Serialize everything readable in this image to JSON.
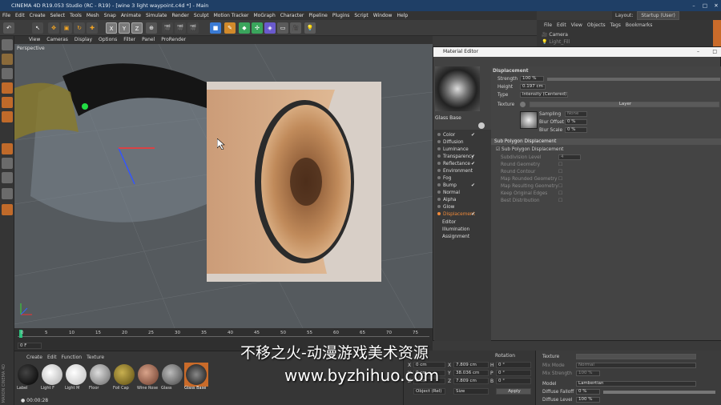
{
  "window": {
    "title": "CINEMA 4D R19.053 Studio (RC - R19) - [wine 3 light waypoint.c4d *] - Main"
  },
  "menu": [
    "File",
    "Edit",
    "Create",
    "Select",
    "Tools",
    "Mesh",
    "Snap",
    "Animate",
    "Simulate",
    "Render",
    "Sculpt",
    "Motion Tracker",
    "MoGraph",
    "Character",
    "Pipeline",
    "Plugins",
    "Script",
    "Window",
    "Help"
  ],
  "layout": {
    "label": "Layout:",
    "value": "Startup (User)"
  },
  "toolbar": {
    "x": "X",
    "y": "Y",
    "z": "Z"
  },
  "viewport": {
    "menu": [
      "View",
      "Cameras",
      "Display",
      "Options",
      "Filter",
      "Panel",
      "ProRender"
    ],
    "label": "Perspective"
  },
  "timeline": {
    "ticks": [
      "0",
      "5",
      "10",
      "15",
      "20",
      "25",
      "30",
      "35",
      "40",
      "45",
      "50",
      "55",
      "60",
      "65",
      "70",
      "75"
    ],
    "frame_field": "0 F",
    "time": "00:00:28"
  },
  "material_manager": {
    "menu": [
      "Create",
      "Edit",
      "Function",
      "Texture"
    ],
    "materials": [
      "Label",
      "Light F",
      "Light M",
      "Floor",
      "Foil Cap",
      "Wine Rose",
      "Glass",
      "Glass Base"
    ]
  },
  "coordinates": {
    "header": "Rotation",
    "rows": [
      {
        "axis": "X",
        "pos": "0 cm",
        "size": "7.809 cm",
        "rot_label": "H",
        "rot": "0 °"
      },
      {
        "axis": "Y",
        "pos": "0 cm",
        "size": "38.036 cm",
        "rot_label": "P",
        "rot": "0 °"
      },
      {
        "axis": "Z",
        "pos": "0 cm",
        "size": "7.809 cm",
        "rot_label": "B",
        "rot": "0 °"
      }
    ],
    "mode_select": "Object (Rel)",
    "size_select": "Size",
    "apply_label": "Apply"
  },
  "object_manager": {
    "menu": [
      "File",
      "Edit",
      "View",
      "Objects",
      "Tags",
      "Bookmarks"
    ],
    "items": [
      "Camera",
      "Light_Fill"
    ]
  },
  "material_editor": {
    "title": "Material Editor",
    "material_name": "Glass Base",
    "channels": [
      {
        "name": "Color",
        "checked": true
      },
      {
        "name": "Diffusion",
        "checked": false
      },
      {
        "name": "Luminance",
        "checked": false
      },
      {
        "name": "Transparency",
        "checked": true
      },
      {
        "name": "Reflectance",
        "checked": true
      },
      {
        "name": "Environment",
        "checked": false
      },
      {
        "name": "Fog",
        "checked": false
      },
      {
        "name": "Bump",
        "checked": true
      },
      {
        "name": "Normal",
        "checked": false
      },
      {
        "name": "Alpha",
        "checked": false
      },
      {
        "name": "Glow",
        "checked": false
      },
      {
        "name": "Displacement",
        "checked": true
      }
    ],
    "extra_items": [
      "Editor",
      "Illumination",
      "Assignment"
    ],
    "displacement": {
      "title": "Displacement",
      "strength_label": "Strength",
      "strength": "100 %",
      "height_label": "Height",
      "height": "0.197 cm",
      "type_label": "Type",
      "type": "Intensity (Centered)",
      "texture_label": "Texture",
      "layer_label": "Layer",
      "sampling_label": "Sampling",
      "sampling": "None",
      "blur_offset_label": "Blur Offset",
      "blur_offset": "0 %",
      "blur_scale_label": "Blur Scale",
      "blur_scale": "0 %"
    },
    "spd": {
      "section": "Sub Polygon Displacement",
      "checkbox_label": "Sub Polygon Displacement",
      "subdivision_label": "Subdivision Level",
      "subdivision": "4",
      "options": [
        "Round Geometry",
        "Round Contour",
        "Map Rounded Geometry",
        "Map Resulting Geometry",
        "Keep Original Edges",
        "Best Distribution"
      ]
    }
  },
  "attribute_bottom": {
    "texture_label": "Texture",
    "mix_mode_label": "Mix Mode",
    "mix_mode": "Normal",
    "mix_strength_label": "Mix Strength",
    "mix_strength": "100 %",
    "model_label": "Model",
    "model": "Lambertian",
    "diffuse_falloff_label": "Diffuse Falloff",
    "diffuse_falloff": "0 %",
    "diffuse_level_label": "Diffuse Level",
    "diffuse_level": "100 %"
  },
  "watermark": {
    "line1": "不移之火-动漫游戏美术资源",
    "line2": "www.byzhihuo.com"
  },
  "brand": "MAXON CINEMA 4D",
  "colors": {
    "accent_orange": "#c96b2a",
    "titlebar": "#1f3f66",
    "viewport_bg": "#555a5e"
  }
}
